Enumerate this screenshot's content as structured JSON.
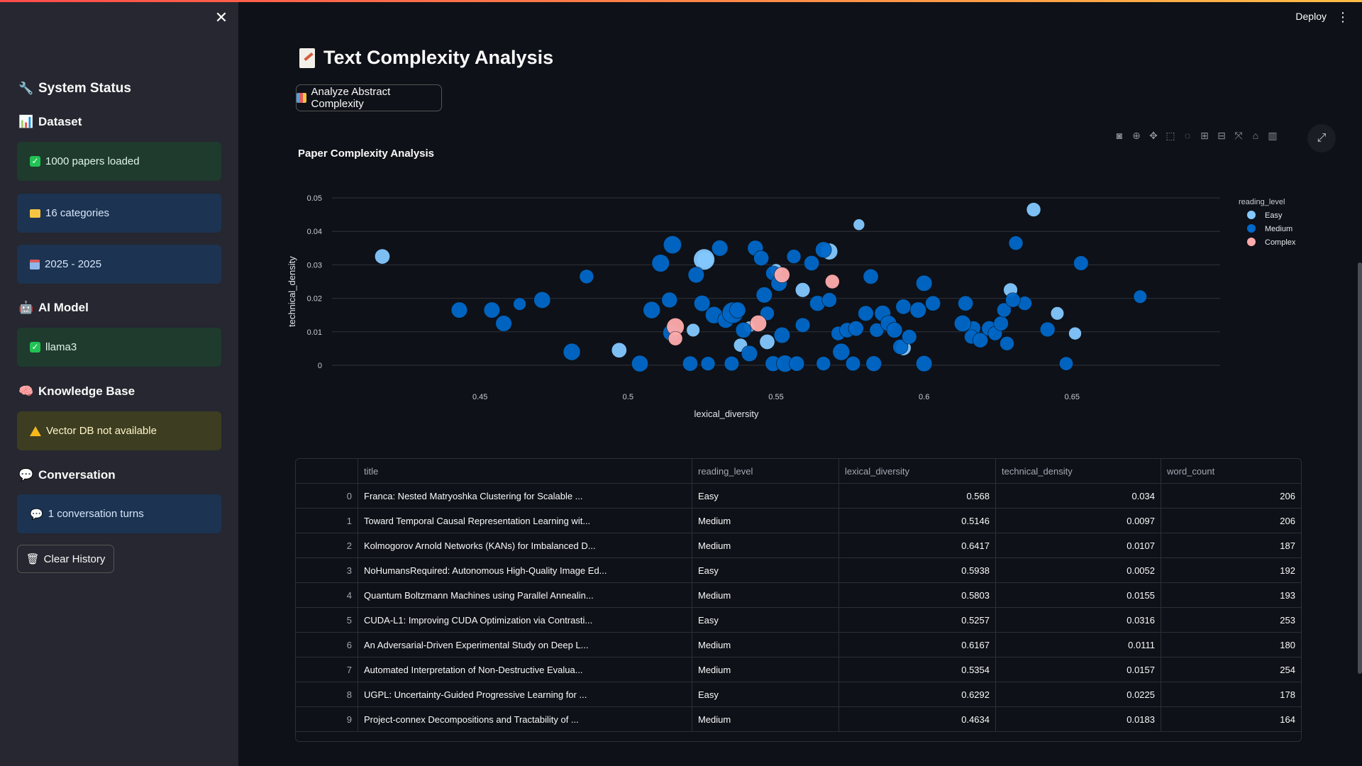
{
  "sidebar": {
    "system_status": "System Status",
    "dataset_heading": "Dataset",
    "papers_loaded": "1000 papers loaded",
    "categories": "16 categories",
    "year_range": "2025 - 2025",
    "ai_model_heading": "AI Model",
    "model_name": "llama3",
    "kb_heading": "Knowledge Base",
    "kb_status": "Vector DB not available",
    "conversation_heading": "Conversation",
    "conversation_turns": "1 conversation turns",
    "clear_history": "Clear History"
  },
  "header": {
    "deploy": "Deploy"
  },
  "main": {
    "title": "Text Complexity Analysis",
    "analyze_button": "Analyze Abstract Complexity"
  },
  "colors": {
    "easy": "#83c9ff",
    "medium": "#0068c9",
    "complex": "#ffabab",
    "accent": "#ff4b4b"
  },
  "chart_data": {
    "type": "scatter",
    "title": "Paper Complexity Analysis",
    "xlabel": "lexical_diversity",
    "ylabel": "technical_density",
    "xlim": [
      0.4,
      0.7
    ],
    "ylim": [
      -0.003,
      0.052
    ],
    "xticks": [
      0.45,
      0.5,
      0.55,
      0.6,
      0.65
    ],
    "yticks": [
      0,
      0.01,
      0.02,
      0.03,
      0.04,
      0.05
    ],
    "xtick_labels": [
      "0.45",
      "0.5",
      "0.55",
      "0.6",
      "0.65"
    ],
    "ytick_labels": [
      "0",
      "0.01",
      "0.02",
      "0.03",
      "0.04",
      "0.05"
    ],
    "legend_title": "reading_level",
    "legend_position": "top-right",
    "grid": true,
    "series": [
      {
        "name": "Easy",
        "color": "#83c9ff",
        "points": [
          [
            0.417,
            0.0325,
            190
          ],
          [
            0.497,
            0.0045,
            190
          ],
          [
            0.526,
            0.0315,
            200
          ],
          [
            0.568,
            0.034,
            206
          ],
          [
            0.538,
            0.006,
            175
          ],
          [
            0.559,
            0.0225,
            185
          ],
          [
            0.593,
            0.0052,
            192
          ],
          [
            0.5257,
            0.0316,
            253
          ],
          [
            0.6292,
            0.0225,
            178
          ],
          [
            0.547,
            0.007,
            190
          ],
          [
            0.637,
            0.0465,
            180
          ],
          [
            0.645,
            0.0155,
            170
          ],
          [
            0.651,
            0.0095,
            165
          ],
          [
            0.578,
            0.042,
            150
          ],
          [
            0.55,
            0.0285,
            160
          ],
          [
            0.541,
            0.0115,
            150
          ],
          [
            0.522,
            0.0105,
            170
          ]
        ]
      },
      {
        "name": "Medium",
        "color": "#0068c9",
        "points": [
          [
            0.443,
            0.0165,
            200
          ],
          [
            0.454,
            0.0165,
            200
          ],
          [
            0.458,
            0.0125,
            200
          ],
          [
            0.4634,
            0.0183,
            164
          ],
          [
            0.471,
            0.0195,
            205
          ],
          [
            0.481,
            0.004,
            210
          ],
          [
            0.486,
            0.0265,
            180
          ],
          [
            0.504,
            0.0005,
            205
          ],
          [
            0.508,
            0.0165,
            210
          ],
          [
            0.511,
            0.0305,
            215
          ],
          [
            0.515,
            0.036,
            220
          ],
          [
            0.5146,
            0.0097,
            206
          ],
          [
            0.514,
            0.0195,
            195
          ],
          [
            0.521,
            0.0005,
            190
          ],
          [
            0.523,
            0.027,
            200
          ],
          [
            0.525,
            0.0185,
            200
          ],
          [
            0.527,
            0.0005,
            180
          ],
          [
            0.529,
            0.015,
            210
          ],
          [
            0.531,
            0.035,
            200
          ],
          [
            0.533,
            0.0135,
            200
          ],
          [
            0.535,
            0.0005,
            185
          ],
          [
            0.5354,
            0.0157,
            254
          ],
          [
            0.537,
            0.0165,
            200
          ],
          [
            0.539,
            0.0105,
            195
          ],
          [
            0.541,
            0.0035,
            200
          ],
          [
            0.543,
            0.035,
            195
          ],
          [
            0.545,
            0.032,
            190
          ],
          [
            0.546,
            0.021,
            200
          ],
          [
            0.547,
            0.0155,
            180
          ],
          [
            0.549,
            0.0275,
            185
          ],
          [
            0.549,
            0.0005,
            195
          ],
          [
            0.551,
            0.0245,
            200
          ],
          [
            0.552,
            0.009,
            200
          ],
          [
            0.553,
            0.0005,
            210
          ],
          [
            0.556,
            0.0325,
            180
          ],
          [
            0.557,
            0.0005,
            190
          ],
          [
            0.559,
            0.012,
            185
          ],
          [
            0.562,
            0.0305,
            190
          ],
          [
            0.564,
            0.0185,
            195
          ],
          [
            0.566,
            0.0005,
            180
          ],
          [
            0.566,
            0.0345,
            200
          ],
          [
            0.568,
            0.0195,
            185
          ],
          [
            0.571,
            0.0095,
            180
          ],
          [
            0.572,
            0.004,
            210
          ],
          [
            0.574,
            0.0105,
            190
          ],
          [
            0.576,
            0.0005,
            185
          ],
          [
            0.577,
            0.011,
            190
          ],
          [
            0.5803,
            0.0155,
            193
          ],
          [
            0.582,
            0.0265,
            190
          ],
          [
            0.583,
            0.0005,
            195
          ],
          [
            0.584,
            0.0105,
            180
          ],
          [
            0.586,
            0.0155,
            200
          ],
          [
            0.588,
            0.0125,
            200
          ],
          [
            0.59,
            0.0105,
            195
          ],
          [
            0.592,
            0.0055,
            190
          ],
          [
            0.593,
            0.0175,
            190
          ],
          [
            0.595,
            0.0085,
            185
          ],
          [
            0.598,
            0.0165,
            200
          ],
          [
            0.6,
            0.0005,
            200
          ],
          [
            0.6,
            0.0245,
            200
          ],
          [
            0.603,
            0.0185,
            190
          ],
          [
            0.6167,
            0.0111,
            180
          ],
          [
            0.613,
            0.0125,
            205
          ],
          [
            0.614,
            0.0185,
            190
          ],
          [
            0.616,
            0.0085,
            180
          ],
          [
            0.619,
            0.0075,
            190
          ],
          [
            0.622,
            0.011,
            190
          ],
          [
            0.624,
            0.0095,
            180
          ],
          [
            0.626,
            0.0125,
            185
          ],
          [
            0.627,
            0.0165,
            180
          ],
          [
            0.6417,
            0.0107,
            187
          ],
          [
            0.628,
            0.0065,
            180
          ],
          [
            0.634,
            0.0185,
            180
          ],
          [
            0.631,
            0.0365,
            180
          ],
          [
            0.648,
            0.0005,
            175
          ],
          [
            0.653,
            0.0305,
            185
          ],
          [
            0.673,
            0.0205,
            170
          ],
          [
            0.63,
            0.0195,
            185
          ]
        ]
      },
      {
        "name": "Complex",
        "color": "#ffabab",
        "points": [
          [
            0.516,
            0.0115,
            215
          ],
          [
            0.516,
            0.008,
            180
          ],
          [
            0.544,
            0.0125,
            205
          ],
          [
            0.552,
            0.027,
            195
          ],
          [
            0.569,
            0.025,
            180
          ]
        ]
      }
    ]
  },
  "table": {
    "columns": [
      "title",
      "reading_level",
      "lexical_diversity",
      "technical_density",
      "word_count"
    ],
    "rows": [
      [
        "0",
        "Franca: Nested Matryoshka Clustering for Scalable ...",
        "Easy",
        "0.568",
        "0.034",
        "206"
      ],
      [
        "1",
        "Toward Temporal Causal Representation Learning wit...",
        "Medium",
        "0.5146",
        "0.0097",
        "206"
      ],
      [
        "2",
        "Kolmogorov Arnold Networks (KANs) for Imbalanced D...",
        "Medium",
        "0.6417",
        "0.0107",
        "187"
      ],
      [
        "3",
        "NoHumansRequired: Autonomous High-Quality Image Ed...",
        "Easy",
        "0.5938",
        "0.0052",
        "192"
      ],
      [
        "4",
        "Quantum Boltzmann Machines using Parallel Annealin...",
        "Medium",
        "0.5803",
        "0.0155",
        "193"
      ],
      [
        "5",
        "CUDA-L1: Improving CUDA Optimization via Contrasti...",
        "Easy",
        "0.5257",
        "0.0316",
        "253"
      ],
      [
        "6",
        "An Adversarial-Driven Experimental Study on Deep L...",
        "Medium",
        "0.6167",
        "0.0111",
        "180"
      ],
      [
        "7",
        "Automated Interpretation of Non-Destructive Evalua...",
        "Medium",
        "0.5354",
        "0.0157",
        "254"
      ],
      [
        "8",
        "UGPL: Uncertainty-Guided Progressive Learning for ...",
        "Easy",
        "0.6292",
        "0.0225",
        "178"
      ],
      [
        "9",
        "Project-connex Decompositions and Tractability of ...",
        "Medium",
        "0.4634",
        "0.0183",
        "164"
      ]
    ]
  }
}
